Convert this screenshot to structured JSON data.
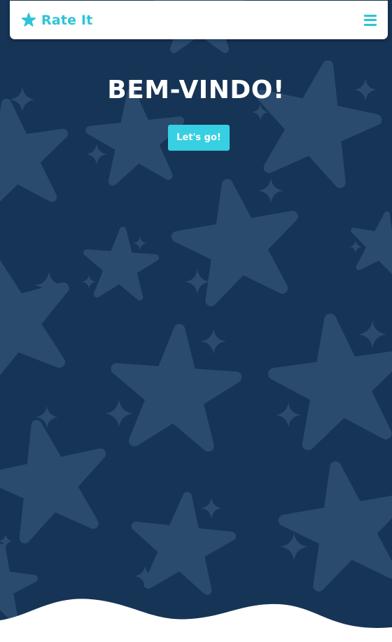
{
  "navbar": {
    "brand_label": "Rate It",
    "brand_icon": "star-icon",
    "menu_icon": "hamburger-menu-icon"
  },
  "hero": {
    "title": "BEM-VINDO!",
    "cta_label": "Let's go!"
  },
  "colors": {
    "background": "#163456",
    "stars": "#2a4b6e",
    "accent": "#2ec4d6",
    "button": "#37d0e2",
    "white": "#ffffff"
  }
}
